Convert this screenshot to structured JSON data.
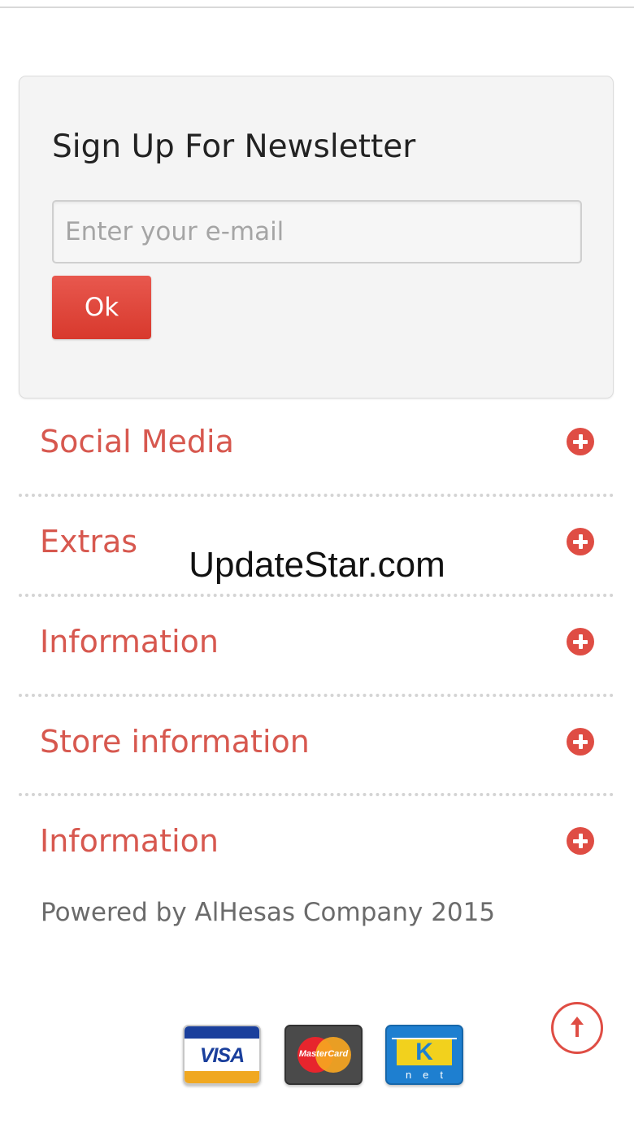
{
  "newsletter": {
    "title": "Sign Up For Newsletter",
    "email_placeholder": "Enter your e-mail",
    "email_value": "",
    "ok_label": "Ok"
  },
  "accordion": [
    {
      "label": "Social Media",
      "icon": "plus-circle-icon"
    },
    {
      "label": "Extras",
      "icon": "plus-circle-icon"
    },
    {
      "label": "Information",
      "icon": "plus-circle-icon"
    },
    {
      "label": "Store information",
      "icon": "plus-circle-icon"
    },
    {
      "label": "Information",
      "icon": "plus-circle-icon"
    }
  ],
  "watermark": "UpdateStar.com",
  "footer": {
    "powered_by": "Powered by AlHesas Company 2015",
    "payment_methods": [
      {
        "name": "visa-card-icon",
        "text": "VISA"
      },
      {
        "name": "mastercard-icon",
        "text": "MasterCard"
      },
      {
        "name": "knet-card-icon",
        "text": "K",
        "subtext": "net"
      }
    ],
    "back_to_top_icon": "arrow-up-circle-icon"
  },
  "colors": {
    "accent": "#df4d44",
    "accordion_text": "#d7584f",
    "button_bg": "#e04a40",
    "panel_bg": "#f4f4f4"
  }
}
